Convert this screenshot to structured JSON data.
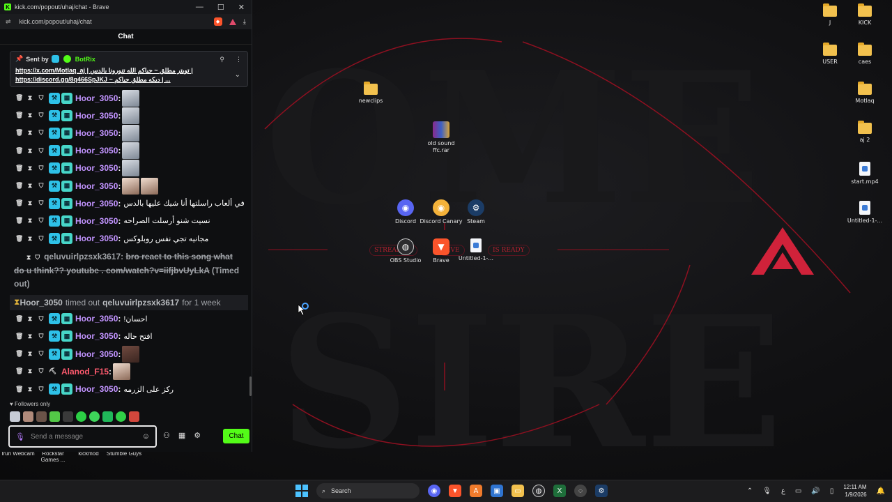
{
  "window": {
    "title": "kick.com/popout/uhaj/chat - Brave",
    "url": "kick.com/popout/uhaj/chat",
    "chat_header": "Chat",
    "minimize": "—",
    "maximize": "☐",
    "close": "✕"
  },
  "pinned": {
    "sent_by_label": "Sent by",
    "bot_name": "BotRix",
    "line1": "https://x.com/Motlaq_aj | تويتر مطلق ~ حياكم الله تنورونا بالدس |",
    "line2": "https://discord.gg/8q466SpJKJ ~ ديكه مطلق حياكم | ..."
  },
  "messages": [
    {
      "user": "Hoor_3050",
      "text": "",
      "emote": "ghost",
      "emote_count": 1
    },
    {
      "user": "Hoor_3050",
      "text": "",
      "emote": "ghost",
      "emote_count": 1
    },
    {
      "user": "Hoor_3050",
      "text": "",
      "emote": "ghost",
      "emote_count": 1
    },
    {
      "user": "Hoor_3050",
      "text": "",
      "emote": "ghost",
      "emote_count": 1
    },
    {
      "user": "Hoor_3050",
      "text": "",
      "emote": "ghost",
      "emote_count": 1
    },
    {
      "user": "Hoor_3050",
      "text": "",
      "emote": "face",
      "emote_count": 2
    },
    {
      "user": "Hoor_3050",
      "text": "في ألعاب راسلتها أنا شيك عليها بالدس",
      "emote": "",
      "emote_count": 0
    },
    {
      "user": "Hoor_3050",
      "text": "نسيت شنو أرسلت الصراحه",
      "emote": "",
      "emote_count": 0
    },
    {
      "user": "Hoor_3050",
      "text": "مجانيه تجي نفس روبلوكس",
      "emote": "",
      "emote_count": 0
    }
  ],
  "timed_out_msg": {
    "user": "qeluvuirlpzsxk3617",
    "text": "bro react to this song what do u think?? youtube . com/watch?v=iifjbvUyLkA",
    "suffix": "(Timed out)"
  },
  "system": {
    "moderator": "Hoor_3050",
    "action": "timed out",
    "target": "qeluvuirlpzsxk3617",
    "duration": "for 1 week"
  },
  "messages2": [
    {
      "user": "Hoor_3050",
      "text": "احسان!",
      "emote": "",
      "red": false
    },
    {
      "user": "Hoor_3050",
      "text": "افتح حاله",
      "emote": "",
      "red": false
    },
    {
      "user": "Hoor_3050",
      "text": "",
      "emote": "dark",
      "red": false
    },
    {
      "user": "Alanod_F15",
      "text": "",
      "emote": "face",
      "red": true
    },
    {
      "user": "Hoor_3050",
      "text": "ركز على الزرمه",
      "emote": "",
      "red": false
    }
  ],
  "composer": {
    "followers_only": "Followers only",
    "placeholder": "Send a message",
    "send_button": "Chat"
  },
  "behind_icons": [
    "Irun Webcam",
    "Rockstar Games ...",
    "kickmod",
    "Stumble Guys"
  ],
  "desktop_icons": {
    "right": [
      "J",
      "KICK",
      "USER",
      "caes",
      "Motlaq",
      "aj 2",
      "start.mp4",
      "Untitled-1-..."
    ],
    "middle": [
      "newclips",
      "old sound ffc.rar",
      "Discord",
      "Discord Canary",
      "Steam",
      "OBS Studio",
      "Brave",
      "Untitled-1-..."
    ]
  },
  "wallpaper_tags": [
    "STREAMER",
    "LIVE",
    "IS READY"
  ],
  "taskbar": {
    "search_label": "Search",
    "time": "12:11 AM",
    "date": "1/9/2026",
    "lang": "ع"
  },
  "colors": {
    "kick_green": "#53fc18",
    "username_purple": "#c294ff",
    "username_red": "#ff5a6e",
    "apex_red": "#d0223a"
  }
}
